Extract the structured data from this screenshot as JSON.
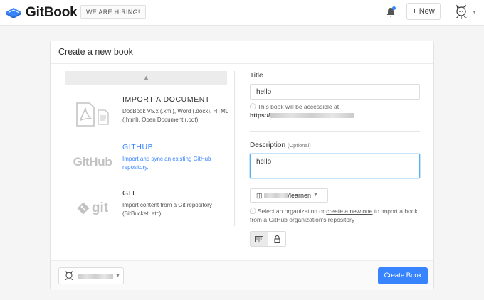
{
  "header": {
    "brand": "GitBook",
    "hiring_label": "WE ARE HIRING!",
    "new_label": "+ New",
    "notification_icon": "bell-icon",
    "user_avatar_icon": "octocat-avatar-icon"
  },
  "card": {
    "title": "Create a new book"
  },
  "sources": {
    "collapse_icon": "chevron-up-icon",
    "items": [
      {
        "title": "IMPORT A DOCUMENT",
        "description": "DocBook V5.x (.xml), Word (.docx), HTML (.html), Open Document (.odt)",
        "icon": "pdf-document-icon"
      },
      {
        "title": "GITHUB",
        "description": "Import and sync an existing GitHub repository.",
        "icon": "github-logo-icon",
        "logo_text": "GitHub"
      },
      {
        "title": "GIT",
        "description": "Import content from a Git repository (BitBucket, etc).",
        "icon": "git-logo-icon",
        "logo_text": "git"
      }
    ]
  },
  "form": {
    "title_label": "Title",
    "title_value": "hello",
    "accessible_note": "This book will be accessible at",
    "accessible_url_prefix": "https://",
    "description_label": "Description",
    "description_optional": "(Optional)",
    "description_value": "hello",
    "repo_suffix": "/learnen",
    "org_help_prefix": "Select an organization or ",
    "org_help_link": "create a new one",
    "org_help_suffix": " to import a book from a GitHub organization's repository"
  },
  "footer": {
    "create_label": "Create Book"
  },
  "colors": {
    "accent": "#3884ff",
    "focus_border": "#58b0ee"
  }
}
